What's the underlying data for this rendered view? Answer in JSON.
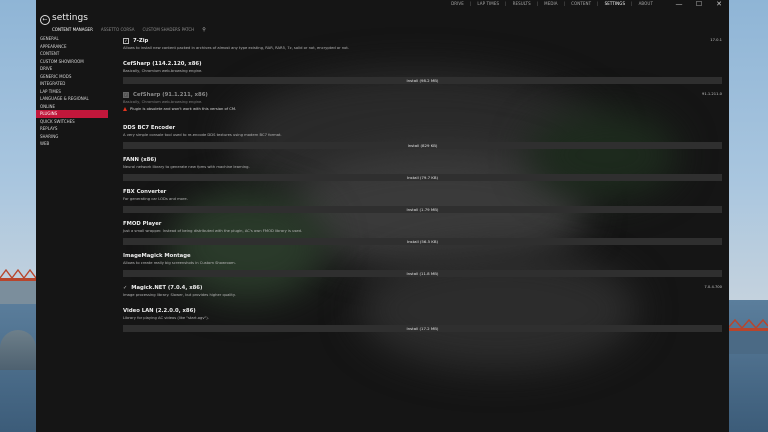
{
  "window": {
    "title": "settings",
    "top_nav": [
      "DRIVE",
      "LAP TIMES",
      "RESULTS",
      "MEDIA",
      "CONTENT",
      "SETTINGS",
      "ABOUT"
    ],
    "top_nav_active": "SETTINGS",
    "controls": {
      "minimize": "—",
      "maximize": "☐",
      "close": "✕"
    }
  },
  "subtabs": [
    "CONTENT MANAGER",
    "ASSETTO CORSA",
    "CUSTOM SHADERS PATCH"
  ],
  "subtab_active": "CONTENT MANAGER",
  "sidebar": {
    "items": [
      "GENERAL",
      "APPEARANCE",
      "CONTENT",
      "CUSTOM SHOWROOM",
      "DRIVE",
      "GENERIC MODS",
      "INTEGRATED",
      "LAP TIMES",
      "LANGUAGE & REGIONAL",
      "ONLINE",
      "PLUGINS",
      "QUICK SWITCHES",
      "REPLAYS",
      "SHARING",
      "WEB"
    ],
    "selected": "PLUGINS"
  },
  "plugins": [
    {
      "name": "7-Zip",
      "desc": "Allows to install new content packed in archives of almost any type existing, RAR, RAR5, 7z, solid or not, encrypted or not.",
      "version": "17.0.1",
      "state": "installed-checked"
    },
    {
      "name": "CefSharp (114.2.120, x86)",
      "desc": "Basically, Chromium web-browsing engine.",
      "button": "Install (98.2 MB)"
    },
    {
      "name": "CefSharp (91.1.211, x86)",
      "desc": "Basically, Chromium web-browsing engine.",
      "version": "91.1.211.0",
      "state": "obsolete",
      "warning": "Plugin is obsolete and won't work with this version of CM."
    },
    {
      "name": "DDS BC7 Encoder",
      "desc": "A very simple console tool used to re-encode DDS textures using modern BC7 format.",
      "button": "Install (829 KB)"
    },
    {
      "name": "FANN (x86)",
      "desc": "Neural network library to generate new fpms with machine learning.",
      "button": "Install (79.7 KB)"
    },
    {
      "name": "FBX Converter",
      "desc": "For generating car LODs and more.",
      "button": "Install (1.79 MB)"
    },
    {
      "name": "FMOD Player",
      "desc": "Just a small wrapper. Instead of being distributed with the plugin, AC's own FMOD library is used.",
      "button": "Install (56.5 KB)"
    },
    {
      "name": "ImageMagick Montage",
      "desc": "Allows to create really big screenshots in Custom Showroom.",
      "button": "Install (11.8 MB)"
    },
    {
      "name": "Magick.NET (7.0.4, x86)",
      "desc": "Image processing library. Slower, but provides higher quality.",
      "version": "7.0.4.700",
      "state": "installed"
    },
    {
      "name": "Video LAN (2.2.0.0, x86)",
      "desc": "Library for playing AC videos (like \"start.ogv\").",
      "button": "Install (17.2 MB)"
    }
  ],
  "colors": {
    "accent": "#c2173b",
    "warning": "#e0341e"
  },
  "icons": {
    "back": "back-arrow-icon",
    "search": "search-icon"
  }
}
